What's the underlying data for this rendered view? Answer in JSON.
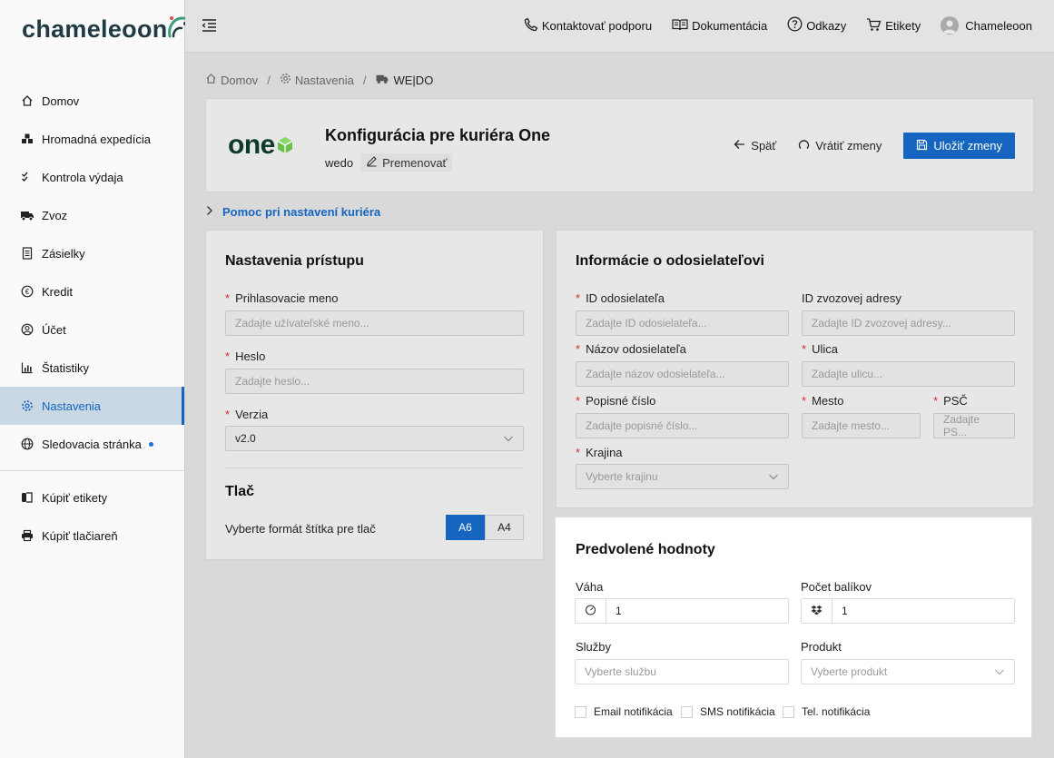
{
  "brand": {
    "name": "chameleoon",
    "accent": "#1565c0"
  },
  "sidebar": {
    "items": [
      {
        "label": "Domov",
        "icon": "home-icon"
      },
      {
        "label": "Hromadná expedícia",
        "icon": "boxes-icon"
      },
      {
        "label": "Kontrola výdaja",
        "icon": "check-list-icon"
      },
      {
        "label": "Zvoz",
        "icon": "truck-icon"
      },
      {
        "label": "Zásielky",
        "icon": "document-icon"
      },
      {
        "label": "Kredit",
        "icon": "euro-icon"
      },
      {
        "label": "Účet",
        "icon": "user-circle-icon"
      },
      {
        "label": "Štatistiky",
        "icon": "bar-chart-icon"
      },
      {
        "label": "Nastavenia",
        "icon": "gear-icon",
        "active": true
      },
      {
        "label": "Sledovacia stránka",
        "icon": "globe-icon"
      }
    ],
    "extra": [
      {
        "label": "Kúpiť etikety",
        "icon": "label-roll-icon"
      },
      {
        "label": "Kúpiť tlačiareň",
        "icon": "printer-icon"
      }
    ]
  },
  "topbar": {
    "support": "Kontaktovať podporu",
    "docs": "Dokumentácia",
    "links": "Odkazy",
    "labels": "Etikety",
    "user": "Chameleoon"
  },
  "breadcrumb": {
    "home": "Domov",
    "settings": "Nastavenia",
    "current": "WE|DO"
  },
  "header": {
    "carrier_logo": "one",
    "title": "Konfigurácia pre kuriéra One",
    "code": "wedo",
    "rename": "Premenovať",
    "back": "Späť",
    "revert": "Vrátiť zmeny",
    "save": "Uložiť zmeny"
  },
  "help": {
    "label": "Pomoc pri nastavení kuriéra"
  },
  "access": {
    "title": "Nastavenia prístupu",
    "login_label": "Prihlasovacie meno",
    "login_placeholder": "Zadajte užívateľské meno...",
    "password_label": "Heslo",
    "password_placeholder": "Zadajte heslo...",
    "version_label": "Verzia",
    "version_value": "v2.0",
    "print_title": "Tlač",
    "print_label": "Vyberte formát štítka pre tlač",
    "formats": [
      "A6",
      "A4"
    ],
    "selected_format": "A6"
  },
  "sender": {
    "title": "Informácie o odosielateľovi",
    "sender_id_label": "ID odosielateľa",
    "sender_id_placeholder": "Zadajte ID odosielateľa...",
    "pickup_id_label": "ID zvozovej adresy",
    "pickup_id_placeholder": "Zadajte ID zvozovej adresy...",
    "sender_name_label": "Názov odosielateľa",
    "sender_name_placeholder": "Zadajte názov odosielateľa...",
    "street_label": "Ulica",
    "street_placeholder": "Zadajte ulicu...",
    "house_no_label": "Popisné číslo",
    "house_no_placeholder": "Zadajte popisné číslo...",
    "city_label": "Mesto",
    "city_placeholder": "Zadajte mesto...",
    "zip_label": "PSČ",
    "zip_placeholder": "Zadajte PS...",
    "country_label": "Krajina",
    "country_placeholder": "Vyberte krajinu"
  },
  "defaults": {
    "title": "Predvolené hodnoty",
    "weight_label": "Váha",
    "weight_value": "1",
    "packages_label": "Počet balíkov",
    "packages_value": "1",
    "services_label": "Služby",
    "services_placeholder": "Vyberte službu",
    "product_label": "Produkt",
    "product_placeholder": "Vyberte produkt",
    "email_notify": "Email notifikácia",
    "sms_notify": "SMS notifikácia",
    "tel_notify": "Tel. notifikácia"
  }
}
